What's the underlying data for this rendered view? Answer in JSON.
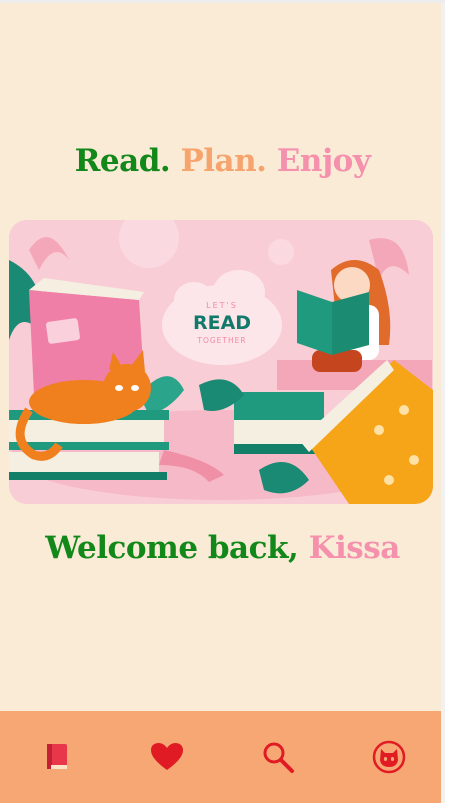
{
  "tagline": {
    "word1": "Read.",
    "word2": "Plan.",
    "word3": "Enjoy"
  },
  "hero": {
    "line1": "LET'S",
    "line2": "READ",
    "line3": "TOGETHER"
  },
  "welcome": {
    "greeting": "Welcome back,",
    "username": "Kissa"
  },
  "bottom_nav": {
    "items": [
      {
        "icon": "book-icon"
      },
      {
        "icon": "heart-icon"
      },
      {
        "icon": "search-icon"
      },
      {
        "icon": "cat-profile-icon"
      }
    ]
  },
  "colors": {
    "background": "#faebd7",
    "green": "#13881a",
    "orange": "#f6a36e",
    "pink": "#f590ad",
    "nav_bar": "#f7a774",
    "icon_red": "#e01b24"
  }
}
